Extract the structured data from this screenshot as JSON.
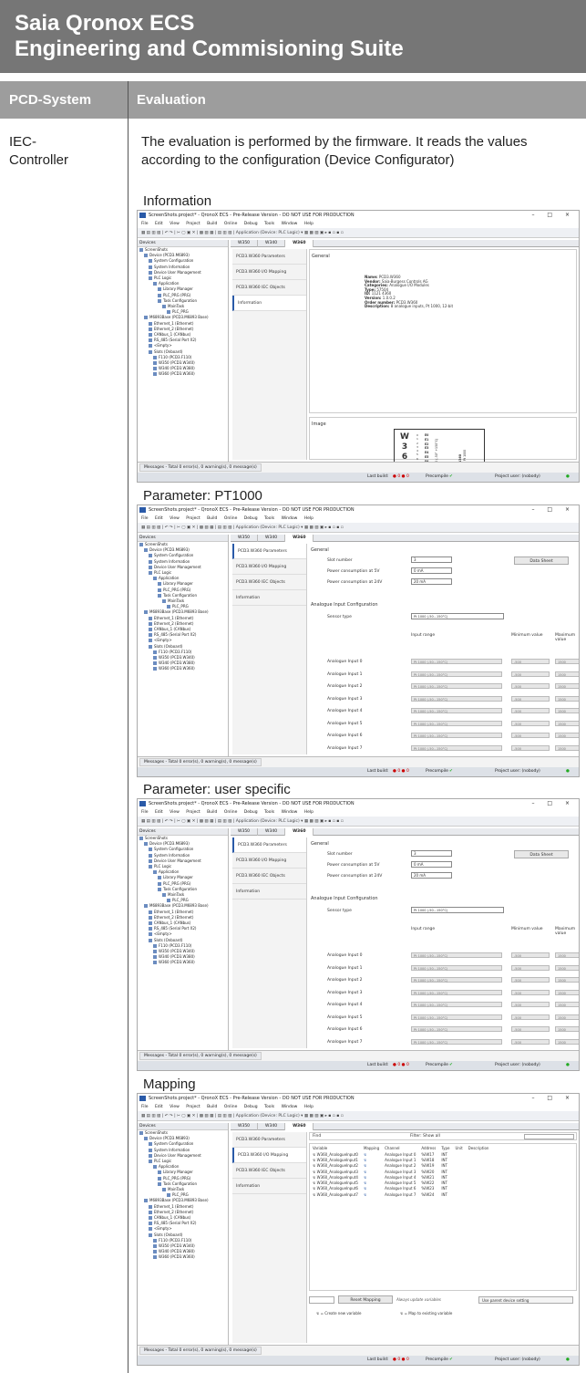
{
  "header": {
    "line1": "Saia Qronox ECS",
    "line2": "Engineering and Commisioning Suite"
  },
  "columns": {
    "col1": "PCD-System",
    "col2": "Evaluation"
  },
  "row": {
    "system_line1": "IEC-",
    "system_line2": "Controller",
    "evaluation_text": "The evaluation is performed by the firmware. It reads the values according to the configuration (Device Configurator)"
  },
  "app": {
    "title": "ScreenShots.project* - QronoX ECS - Pre-Release Version - DO NOT USE FOR PRODUCTION",
    "window_controls": "– □ ×",
    "menu": [
      "File",
      "Edit",
      "View",
      "Project",
      "Build",
      "Online",
      "Debug",
      "Tools",
      "Window",
      "Help"
    ],
    "toolbar_text": "Application (Device: PLC Logic)",
    "devices_header": "Devices",
    "tree": [
      {
        "t": "ScreenShots",
        "l": 0
      },
      {
        "t": "Device (PCD3.M6893)",
        "l": 1
      },
      {
        "t": "System Configuration",
        "l": 2
      },
      {
        "t": "System Information",
        "l": 2
      },
      {
        "t": "Device User Management",
        "l": 2
      },
      {
        "t": "PLC Logic",
        "l": 2
      },
      {
        "t": "Application",
        "l": 3
      },
      {
        "t": "Library Manager",
        "l": 4
      },
      {
        "t": "PLC_PRG (PRG)",
        "l": 4
      },
      {
        "t": "Task Configuration",
        "l": 4
      },
      {
        "t": "MainTask",
        "l": 5
      },
      {
        "t": "PLC_PRG",
        "l": 6
      },
      {
        "t": "M6893Base (PCD3.M6893 Base)",
        "l": 1
      },
      {
        "t": "Ethernet_1 (Ethernet)",
        "l": 2
      },
      {
        "t": "Ethernet_2 (Ethernet)",
        "l": 2
      },
      {
        "t": "CANbus_1 (CANbus)",
        "l": 2
      },
      {
        "t": "RS_485 (Serial Port X2)",
        "l": 2
      },
      {
        "t": "<Empty>",
        "l": 2
      },
      {
        "t": "Slots (Onboard)",
        "l": 2
      },
      {
        "t": "F110 (PCD3.F110)",
        "l": 3
      },
      {
        "t": "W350 (PCD3.W340)",
        "l": 3
      },
      {
        "t": "W340 (PCD3.W380)",
        "l": 3
      },
      {
        "t": "W360 (PCD3.W360)",
        "l": 3
      }
    ],
    "tabs": [
      "W350",
      "W340",
      "W360"
    ],
    "nav": [
      "PCD3.W360 Parameters",
      "PCD3.W360 I/O Mapping",
      "PCD3.W360 IEC Objects",
      "Information"
    ],
    "messages": "Messages - Total 0 error(s), 0 warning(s), 0 message(s)",
    "last_build": "Last build:",
    "precompile": "Precompile",
    "project_user": "Project user: (nobody)"
  },
  "info": {
    "caption": "Information",
    "general": "General",
    "image": "Image",
    "details": [
      {
        "k": "Name:",
        "v": "PCD3.W360"
      },
      {
        "k": "Vendor:",
        "v": "Saia-Burgess Controls AG"
      },
      {
        "k": "Categories:",
        "v": "Analogue I/O Modules"
      },
      {
        "k": "Type:",
        "v": "57504"
      },
      {
        "k": "ID:",
        "v": "1121 4360"
      },
      {
        "k": "Version:",
        "v": "1.0.0.2"
      },
      {
        "k": "Order number:",
        "v": "PCD3.W360"
      },
      {
        "k": "Description:",
        "v": "8 analogue inputs, Pt 1000, 12-bit"
      }
    ],
    "module": {
      "big": [
        "W",
        "3",
        "6",
        "0"
      ],
      "channels": [
        "E0",
        "E1",
        "E2",
        "E3",
        "E4",
        "E5",
        "E6",
        "E7",
        "COM"
      ],
      "nums": [
        "0",
        "1",
        "2",
        "3",
        "4",
        "5",
        "6",
        "7",
        "8",
        "9"
      ],
      "side": "Pt 1000 (-50° +150°C)",
      "side2": "PCD3.W360",
      "side3": "8 inputs Pt 1000"
    }
  },
  "param1": {
    "caption": "Parameter: PT1000"
  },
  "param2": {
    "caption": "Parameter: user specific"
  },
  "params": {
    "general": "General",
    "slot_label": "Slot number",
    "slot_value": "3",
    "p5_label": "Power consumption at 5V",
    "p5_value": "0 mA",
    "p24_label": "Power consumption at 24V",
    "p24_value": "20 mA",
    "datasheet": "Data Sheet",
    "aic": "Analogue Input Configuration",
    "sensor_label": "Sensor type",
    "sensor_value": "Pt 1000 (-50...150°C)",
    "h_range": "Input range",
    "h_min": "Minimum value",
    "h_max": "Maximum value",
    "inputs": [
      "Analogue Input 0",
      "Analogue Input 1",
      "Analogue Input 2",
      "Analogue Input 3",
      "Analogue Input 4",
      "Analogue Input 5",
      "Analogue Input 6",
      "Analogue Input 7"
    ],
    "range_value": "Pt 1000 (-50...150°C)",
    "min_value": "-500",
    "max_value": "1500"
  },
  "mapping": {
    "caption": "Mapping",
    "find": "Find",
    "filter": "Filter",
    "show_all": "Show all",
    "headers": [
      "Variable",
      "Mapping",
      "Channel",
      "Address",
      "Type",
      "Unit",
      "Description"
    ],
    "rows": [
      [
        "W360_AnalogueInput0",
        "Analogue Input 0",
        "%IW17",
        "INT"
      ],
      [
        "W360_AnalogueInput1",
        "Analogue Input 1",
        "%IW18",
        "INT"
      ],
      [
        "W360_AnalogueInput2",
        "Analogue Input 2",
        "%IW19",
        "INT"
      ],
      [
        "W360_AnalogueInput3",
        "Analogue Input 3",
        "%IW20",
        "INT"
      ],
      [
        "W360_AnalogueInput4",
        "Analogue Input 4",
        "%IW21",
        "INT"
      ],
      [
        "W360_AnalogueInput5",
        "Analogue Input 5",
        "%IW22",
        "INT"
      ],
      [
        "W360_AnalogueInput6",
        "Analogue Input 6",
        "%IW23",
        "INT"
      ],
      [
        "W360_AnalogueInput7",
        "Analogue Input 7",
        "%IW24",
        "INT"
      ]
    ],
    "reset": "Reset Mapping",
    "always": "Always update variables",
    "use_parent": "Use parent device setting",
    "legend1": "= Create new variable",
    "legend2": "= Map to existing variable"
  }
}
